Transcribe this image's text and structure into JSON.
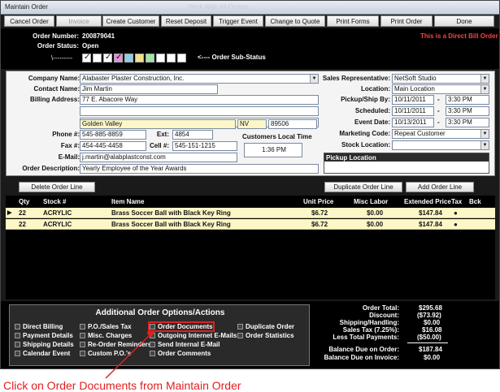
{
  "window": {
    "title": "Maintain Order",
    "caption": "Work With All Orders"
  },
  "toolbar": {
    "cancel": "Cancel Order",
    "invoice": "Invoice",
    "create_customer": "Create Customer",
    "reset_deposit": "Reset Deposit",
    "trigger_event": "Trigger Event",
    "change_quote": "Change to Quote",
    "print_forms": "Print Forms",
    "print_order": "Print Order",
    "done": "Done"
  },
  "header": {
    "order_number_label": "Order Number:",
    "order_number": "200879041",
    "order_status_label": "Order Status:",
    "order_status": "Open",
    "direct_bill": "This is a Direct Bill Order",
    "substatus_lead": "\\---------",
    "substatus_label": "<---- Order Sub-Status",
    "substatus_colors": [
      "#ffffff",
      "#ffffff",
      "#ffffff",
      "#e48de0",
      "#8ecbe8",
      "#f0e08a",
      "#9ee5a0",
      "#ffffff",
      "#ffffff",
      "#ffffff"
    ],
    "substatus_checked": [
      true,
      false,
      true,
      true,
      false,
      false,
      false,
      false,
      false,
      false
    ]
  },
  "form": {
    "company_label": "Company Name:",
    "company": "Alabaster Plaster Construction, Inc.",
    "contact_label": "Contact Name:",
    "contact": "Jim Martin",
    "billing_label": "Billing Address:",
    "address1": "77 E. Abacore Way",
    "address2": "",
    "address3": "",
    "city": "Golden Valley",
    "state": "NV",
    "zip": "89506",
    "phone_label": "Phone #:",
    "phone": "545-885-8859",
    "ext_label": "Ext:",
    "ext": "4854",
    "fax_label": "Fax #:",
    "fax": "454-445-4458",
    "cell_label": "Cell #:",
    "cell": "545-151-1215",
    "email_label": "E-Mail:",
    "email": "j.martin@alabplastconst.com",
    "desc_label": "Order Description:",
    "desc": "Yearly Employee of the Year Awards",
    "local_time_label": "Customers Local Time",
    "local_time": "1:36 PM",
    "rep_label": "Sales Representative:",
    "rep": "NetSoft Studio",
    "location_label": "Location:",
    "location": "Main Location",
    "pickup_label": "Pickup/Ship By:",
    "pickup_date": "10/11/2011",
    "pickup_time": "3:30 PM",
    "scheduled_label": "Scheduled:",
    "scheduled_date": "10/11/2011",
    "scheduled_time": "3:30 PM",
    "event_label": "Event Date:",
    "event_date": "10/13/2011",
    "event_time": "3:30 PM",
    "marketing_label": "Marketing Code:",
    "marketing": "Repeat Customer",
    "stock_label": "Stock Location:",
    "stock": "",
    "pickup_location_label": "Pickup Location",
    "dash": "-"
  },
  "lines": {
    "delete": "Delete Order Line",
    "duplicate": "Duplicate Order Line",
    "add": "Add Order Line",
    "headers": {
      "qty": "Qty",
      "stock": "Stock #",
      "item": "Item Name",
      "unit": "Unit Price",
      "misc": "Misc Labor",
      "ext": "Extended Price",
      "tax": "Tax",
      "bck": "Bck"
    },
    "rows": [
      {
        "qty": "22",
        "stock": "ACRYLIC",
        "item": "Brass Soccer Ball with Black Key Ring",
        "unit": "$6.72",
        "misc": "$0.00",
        "ext": "$147.84",
        "tax": "●"
      },
      {
        "qty": "22",
        "stock": "ACRYLIC",
        "item": "Brass Soccer Ball with Black Key Ring",
        "unit": "$6.72",
        "misc": "$0.00",
        "ext": "$147.84",
        "tax": "●"
      }
    ]
  },
  "options": {
    "title": "Additional Order Options/Actions",
    "direct_billing": "Direct Billing",
    "payment_details": "Payment Details",
    "shipping_details": "Shipping Details",
    "calendar_event": "Calendar Event",
    "po_sales_tax": "P.O./Sales Tax",
    "misc_charges": "Misc. Charges",
    "re_order": "Re-Order Reminders",
    "custom_po": "Custom P.O.'s",
    "order_documents": "Order Documents",
    "outgoing_email": "Outgoing Internet E-Mails",
    "send_email": "Send Internal E-Mail",
    "order_comments": "Order Comments",
    "duplicate_order": "Duplicate Order",
    "order_statistics": "Order Statistics"
  },
  "totals": {
    "order_total_label": "Order Total:",
    "order_total": "$295.68",
    "discount_label": "Discount:",
    "discount": "($73.92)",
    "shipping_label": "Shipping/Handling:",
    "shipping": "$0.00",
    "sales_tax_label": "Sales Tax (7.25%):",
    "sales_tax": "$16.08",
    "payments_label": "Less Total Payments:",
    "payments": "($50.00)",
    "balance_order_label": "Balance Due on Order:",
    "balance_order": "$187.84",
    "balance_invoice_label": "Balance Due on Invoice:",
    "balance_invoice": "$0.00"
  },
  "annotation": {
    "caption": "Click on Order Documents from Maintain Order",
    "color": "#e02020"
  }
}
